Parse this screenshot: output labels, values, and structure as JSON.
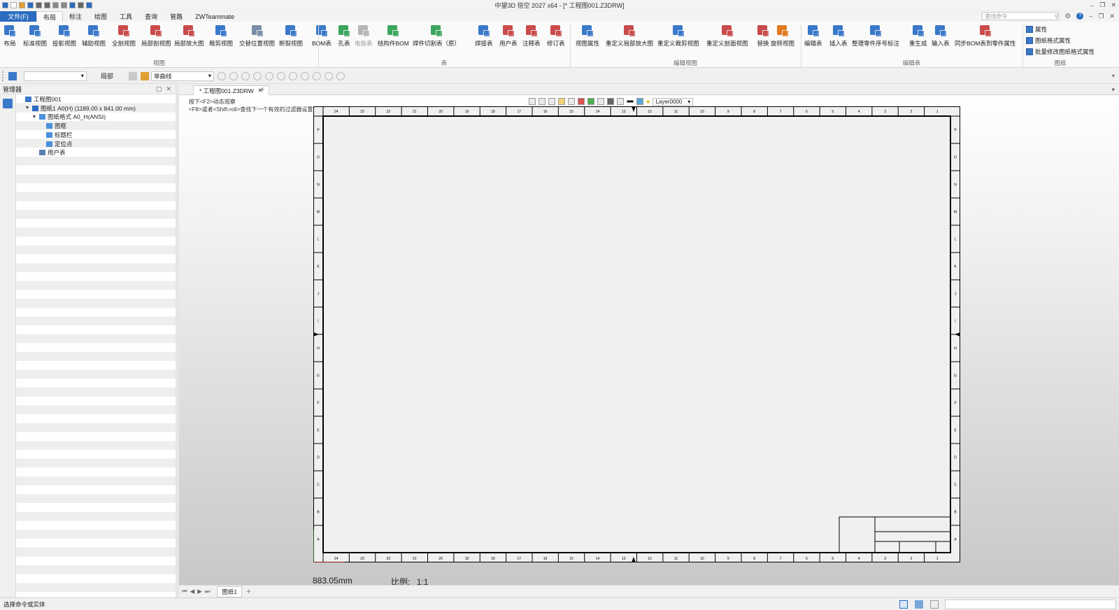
{
  "title_bar": {
    "title": "中望3D 倍空 2027 x64 - [* 工程图001.Z3DRW]",
    "quick_access": [
      "app-logo-icon",
      "new-file-icon",
      "open-folder-icon",
      "save-icon",
      "print-icon",
      "print-preview-icon",
      "undo-icon",
      "redo-icon",
      "regen-icon",
      "dropdown-icon",
      "run-icon"
    ],
    "window_controls": [
      "minimize-icon",
      "restore-icon",
      "close-icon"
    ]
  },
  "menu": {
    "file_label": "文件(F)",
    "tabs": [
      "布局",
      "标注",
      "绘图",
      "工具",
      "查询",
      "管路",
      "ZWTeammate"
    ],
    "active_tab": "布局",
    "search_placeholder": "查找命令"
  },
  "ribbon": {
    "buttons": [
      {
        "label": "布局",
        "icon": "layout-icon",
        "color": "#3a78c9"
      },
      {
        "label": "标准视图",
        "icon": "standard-view-icon",
        "color": "#3a78c9"
      },
      {
        "label": "投影视图",
        "icon": "projection-view-icon",
        "color": "#3a78c9"
      },
      {
        "label": "辅助视图",
        "icon": "auxiliary-view-icon",
        "color": "#3a78c9"
      },
      {
        "label": "全剖视图",
        "icon": "full-section-icon",
        "color": "#c94b4b"
      },
      {
        "label": "局部剖视图",
        "icon": "local-section-icon",
        "color": "#c94b4b"
      },
      {
        "label": "局部放大图",
        "icon": "detail-view-icon",
        "color": "#c94b4b"
      },
      {
        "label": "裁剪视图",
        "icon": "crop-view-icon",
        "color": "#3a78c9"
      },
      {
        "label": "交替位置视图",
        "icon": "alternate-position-icon",
        "color": "#7a8fa8"
      },
      {
        "label": "断裂视图",
        "icon": "break-view-icon",
        "color": "#3a78c9"
      },
      {
        "label": "BOM表",
        "icon": "bom-table-icon",
        "color": "#3a78c9"
      },
      {
        "label": "孔表",
        "icon": "hole-table-icon",
        "color": "#3ba55c"
      },
      {
        "label": "电极表",
        "icon": "electrode-table-icon",
        "color": "#b5b5b5",
        "dim": true
      },
      {
        "label": "结构件BOM",
        "icon": "structure-bom-icon",
        "color": "#3ba55c"
      },
      {
        "label": "焊件切割表（原）",
        "icon": "weld-cut-table-icon",
        "color": "#3ba55c"
      },
      {
        "label": "焊接表",
        "icon": "weld-table-icon",
        "color": "#3a78c9"
      },
      {
        "label": "用户表",
        "icon": "user-table-icon",
        "color": "#c94b4b"
      },
      {
        "label": "注释表",
        "icon": "note-table-icon",
        "color": "#c94b4b"
      },
      {
        "label": "修订表",
        "icon": "revision-table-icon",
        "color": "#c94b4b"
      },
      {
        "label": "视图属性",
        "icon": "view-properties-icon",
        "color": "#3a78c9"
      },
      {
        "label": "重定义局部放大图",
        "icon": "redefine-detail-icon",
        "color": "#c94b4b"
      },
      {
        "label": "重定义裁剪视图",
        "icon": "redefine-crop-icon",
        "color": "#3a78c9"
      },
      {
        "label": "重定义剖面视图",
        "icon": "redefine-section-icon",
        "color": "#c94b4b"
      },
      {
        "label": "替换",
        "icon": "replace-icon",
        "color": "#c94b4b"
      },
      {
        "label": "旋转视图",
        "icon": "rotate-view-icon",
        "color": "#e07a1f"
      },
      {
        "label": "编辑表",
        "icon": "edit-table-icon",
        "color": "#3a78c9"
      },
      {
        "label": "插入表",
        "icon": "insert-table-icon",
        "color": "#3a78c9"
      },
      {
        "label": "整理零件序号标注",
        "icon": "balloon-arrange-icon",
        "color": "#3a78c9"
      },
      {
        "label": "重生成",
        "icon": "regenerate-icon",
        "color": "#3a78c9"
      },
      {
        "label": "输入表",
        "icon": "input-table-icon",
        "color": "#3a78c9"
      },
      {
        "label": "同步BOM表到零件属性",
        "icon": "sync-bom-icon",
        "color": "#c94b4b"
      }
    ],
    "groups": [
      "视图",
      "表",
      "编辑视图",
      "编辑表",
      "图纸"
    ],
    "small_buttons": [
      "属性",
      "图纸格式属性",
      "批量修改图纸格式属性"
    ]
  },
  "toolbar2": {
    "layer_combo": "",
    "local_label": "局部",
    "filter_combo": "单曲线"
  },
  "manager": {
    "title": "管理器",
    "tree": [
      {
        "label": "工程图001",
        "level": 0,
        "arrow": "",
        "icon": "drawing-icon"
      },
      {
        "label": "图纸1 A0(H) (1189.00 x 841.00 mm)",
        "level": 1,
        "arrow": "▼",
        "icon": "sheet-icon"
      },
      {
        "label": "图纸格式 A0_H(ANSI)",
        "level": 2,
        "arrow": "▼",
        "icon": "format-icon"
      },
      {
        "label": "图框",
        "level": 3,
        "arrow": "",
        "icon": "frame-icon"
      },
      {
        "label": "标题栏",
        "level": 3,
        "arrow": "",
        "icon": "titleblock-icon"
      },
      {
        "label": "定位点",
        "level": 3,
        "arrow": "",
        "icon": "anchor-icon"
      },
      {
        "label": "用户表",
        "level": 2,
        "arrow": "",
        "icon": "usertable-icon"
      }
    ]
  },
  "document": {
    "tab_label": "* 工程图001.Z3DRW",
    "hint_line1": "按下<F2>动态观察",
    "hint_line2": "<F8>或者<Shift-roll>查找下一个有效的过滤器设置",
    "layer": "Layer0000",
    "readout": "883.05mm",
    "scale_label": "比例:",
    "scale_value": "1:1"
  },
  "sheet_tabs": {
    "label": "图纸1"
  },
  "status": {
    "message": "选择命令或实体"
  },
  "border_zones": {
    "columns": [
      "24",
      "23",
      "22",
      "21",
      "20",
      "19",
      "18",
      "17",
      "16",
      "15",
      "14",
      "13",
      "12",
      "11",
      "10",
      "9",
      "8",
      "7",
      "6",
      "5",
      "4",
      "3",
      "2",
      "1"
    ],
    "rows": [
      "P",
      "O",
      "N",
      "M",
      "L",
      "K",
      "J",
      "I",
      "H",
      "G",
      "F",
      "E",
      "D",
      "C",
      "B",
      "A"
    ]
  }
}
